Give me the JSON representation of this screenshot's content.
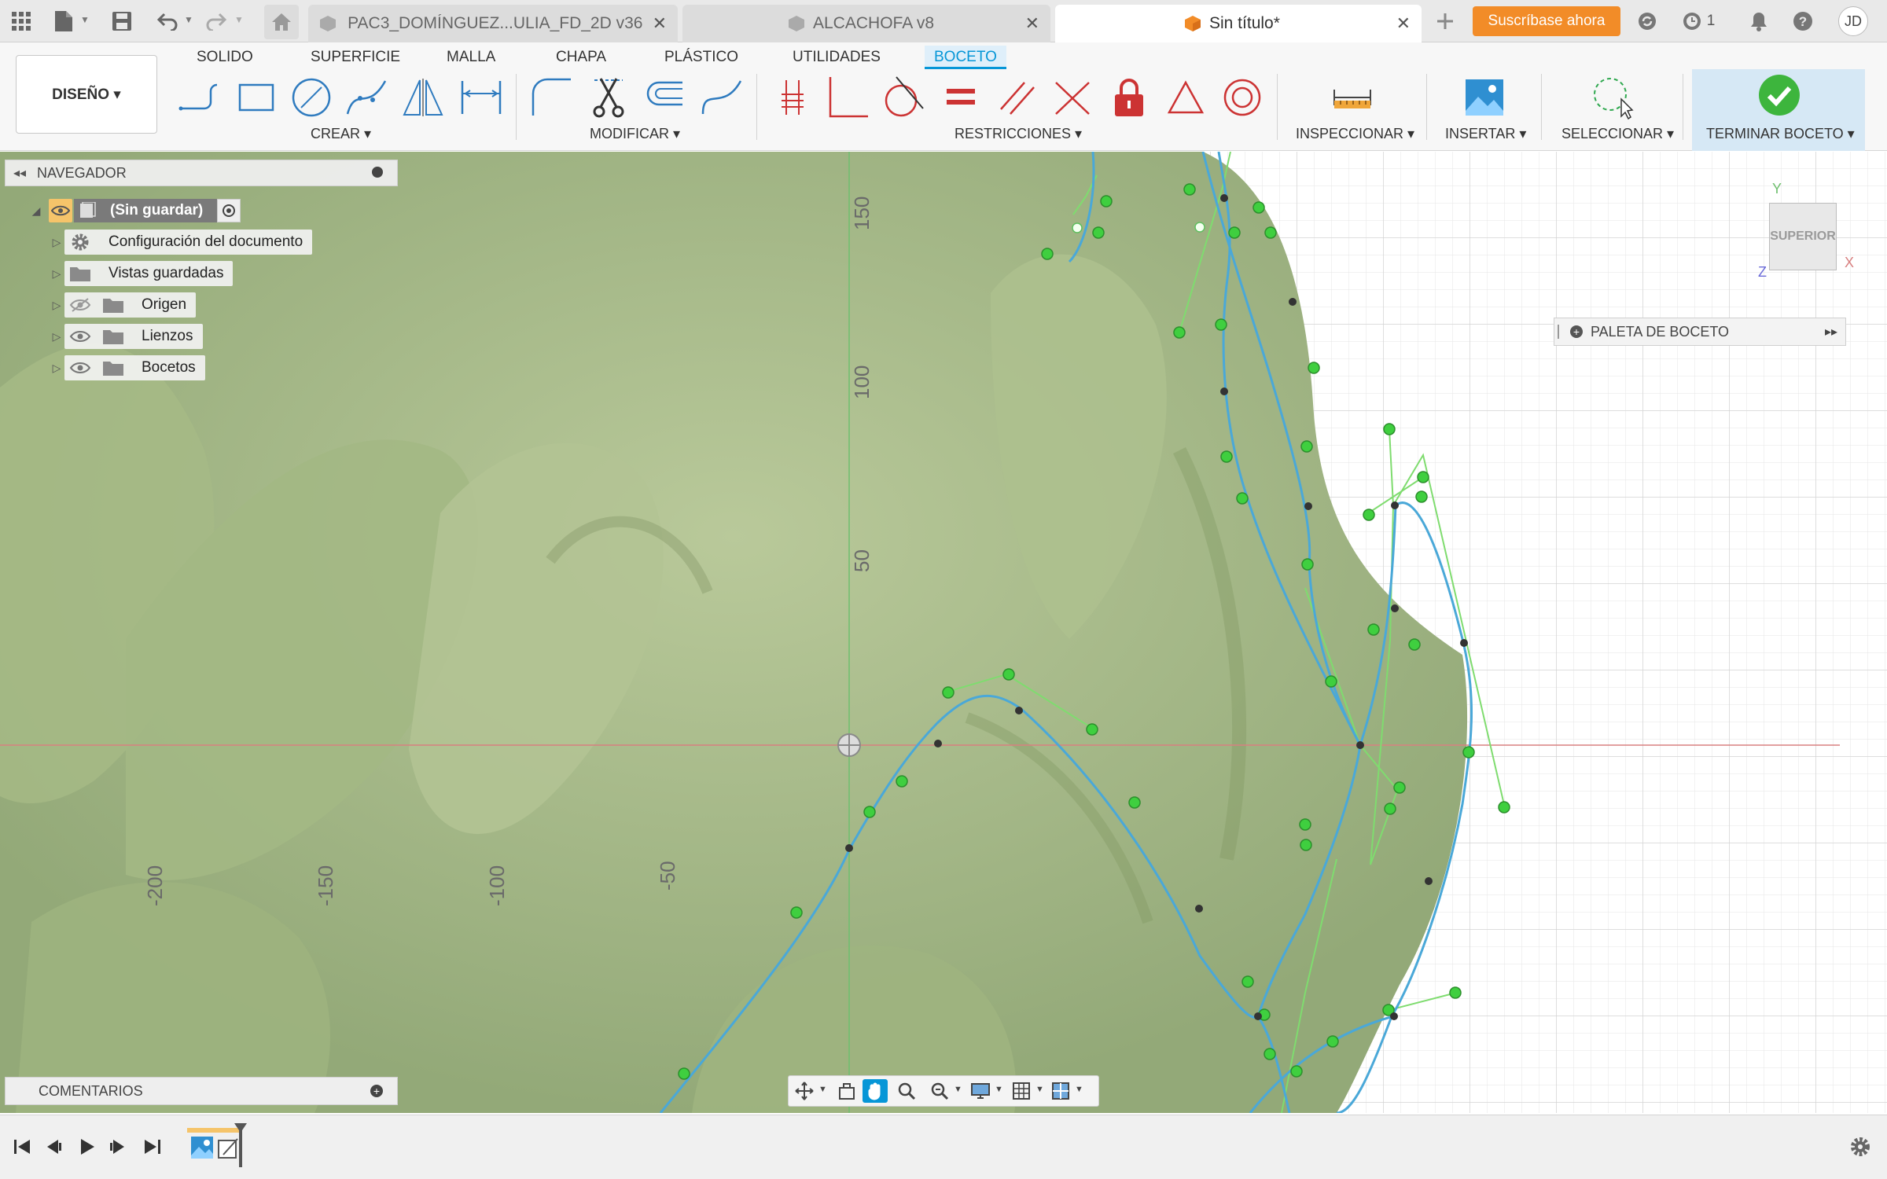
{
  "tabs": [
    {
      "label": "PAC3_DOMÍNGUEZ...ULIA_FD_2D v36",
      "active": false
    },
    {
      "label": "ALCACHOFA v8",
      "active": false
    },
    {
      "label": "Sin título*",
      "active": true
    }
  ],
  "subscribe_label": "Suscríbase ahora",
  "job_count": "1",
  "user_initials": "JD",
  "workspace_label": "DISEÑO ▾",
  "ribbon_tabs": [
    "SOLIDO",
    "SUPERFICIE",
    "MALLA",
    "CHAPA",
    "PLÁSTICO",
    "UTILIDADES",
    "BOCETO"
  ],
  "active_ribbon_tab": "BOCETO",
  "groups": {
    "crear": "CREAR ▾",
    "modificar": "MODIFICAR ▾",
    "restricciones": "RESTRICCIONES ▾",
    "inspeccionar": "INSPECCIONAR ▾",
    "insertar": "INSERTAR ▾",
    "seleccionar": "SELECCIONAR ▾",
    "terminar": "TERMINAR BOCETO ▾"
  },
  "navigator": {
    "title": "NAVEGADOR",
    "root": "(Sin guardar)",
    "items": [
      {
        "label": "Configuración del documento",
        "icon": "gear-icon"
      },
      {
        "label": "Vistas guardadas",
        "icon": "folder-icon"
      },
      {
        "label": "Origen",
        "icon": "folder-icon",
        "hidden": true
      },
      {
        "label": "Lienzos",
        "icon": "folder-icon"
      },
      {
        "label": "Bocetos",
        "icon": "folder-icon"
      }
    ]
  },
  "palette_label": "PALETA DE BOCETO",
  "comments_label": "COMENTARIOS",
  "viewcube_label": "SUPERIOR",
  "axes": {
    "x": "X",
    "y": "Y",
    "z": "Z"
  },
  "ruler": {
    "x_ticks": [
      "-200",
      "-150",
      "-100",
      "-50"
    ],
    "y_ticks": [
      "150",
      "100",
      "50"
    ]
  },
  "colors": {
    "accent": "#0696d7",
    "subscribe": "#f28c28",
    "finish_check": "#3db53d",
    "spline": "#4aa8d8",
    "handle": "#3fcf3f",
    "x_axis": "#d88080",
    "y_axis": "#6fbf6f"
  }
}
